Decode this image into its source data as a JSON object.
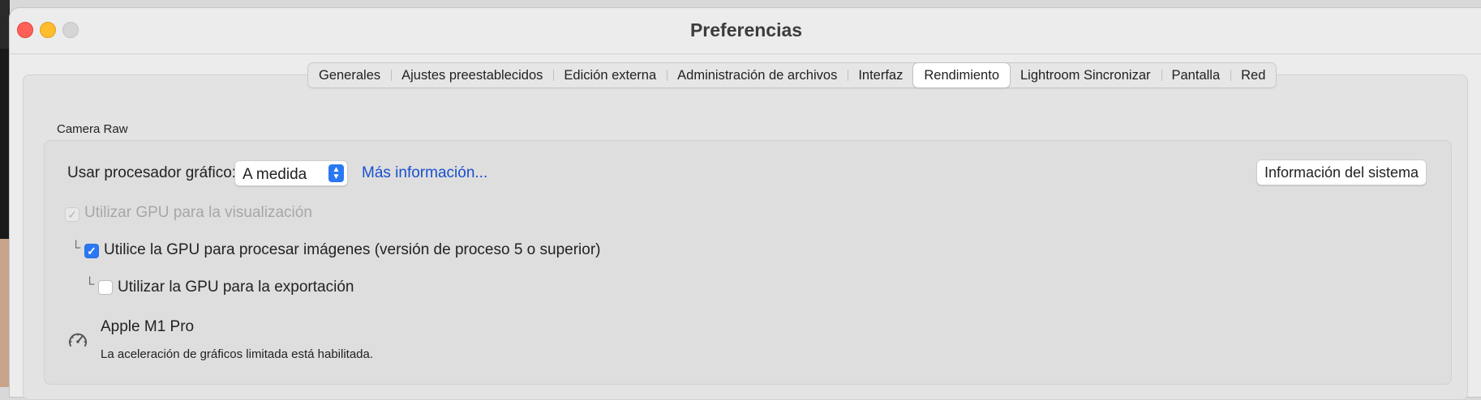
{
  "window": {
    "title": "Preferencias"
  },
  "tabs": [
    {
      "label": "Generales",
      "active": false
    },
    {
      "label": "Ajustes preestablecidos",
      "active": false
    },
    {
      "label": "Edición externa",
      "active": false
    },
    {
      "label": "Administración de archivos",
      "active": false
    },
    {
      "label": "Interfaz",
      "active": false
    },
    {
      "label": "Rendimiento",
      "active": true
    },
    {
      "label": "Lightroom Sincronizar",
      "active": false
    },
    {
      "label": "Pantalla",
      "active": false
    },
    {
      "label": "Red",
      "active": false
    }
  ],
  "camera_raw": {
    "group_label": "Camera Raw",
    "gpu_select_label": "Usar procesador gráfico:",
    "gpu_select_value": "A medida",
    "more_info_link": "Más información...",
    "system_info_button": "Información del sistema",
    "options": [
      {
        "label": "Utilizar GPU para la visualización",
        "checked": true,
        "enabled": false
      },
      {
        "label": "Utilice la GPU para procesar imágenes (versión de proceso 5 o superior)",
        "checked": true,
        "enabled": true
      },
      {
        "label": "Utilizar la GPU para la exportación",
        "checked": false,
        "enabled": true
      }
    ],
    "gpu_name": "Apple M1 Pro",
    "gpu_status": "La aceleración de gráficos limitada está habilitada."
  },
  "colors": {
    "accent": "#2a78f1",
    "link": "#1a4fcf",
    "close": "#fe5f57",
    "minimize": "#febc2e"
  },
  "icons": {
    "gpu": "speedometer-icon",
    "checkmark": "checkmark-icon",
    "select": "chevron-updown-icon"
  }
}
